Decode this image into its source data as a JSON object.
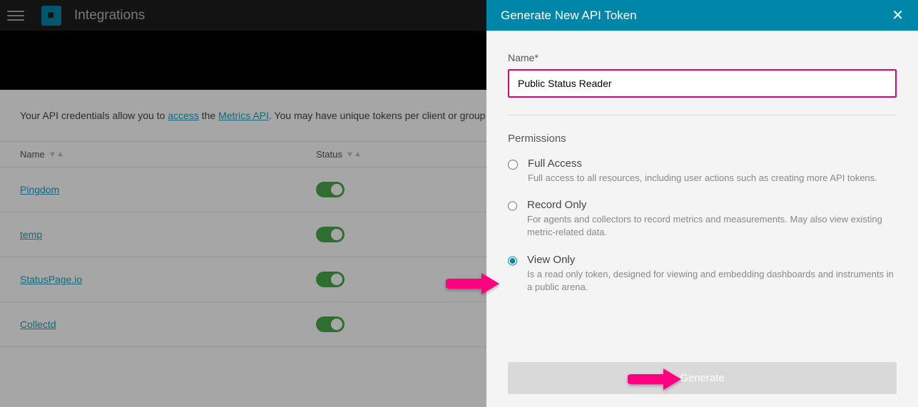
{
  "header": {
    "title": "Integrations"
  },
  "intro": {
    "prefix": "Your API credentials allow you to ",
    "link1": "access",
    "mid": " the ",
    "link2": "Metrics API",
    "suffix": ". You may have unique tokens per client or group of clients."
  },
  "table": {
    "col_name": "Name",
    "col_status": "Status",
    "rows": [
      {
        "name": "Pingdom"
      },
      {
        "name": "temp"
      },
      {
        "name": "StatusPage.io"
      },
      {
        "name": "Collectd"
      }
    ]
  },
  "panel": {
    "title": "Generate New API Token",
    "name_label": "Name*",
    "name_value": "Public Status Reader",
    "permissions_label": "Permissions",
    "options": [
      {
        "title": "Full Access",
        "desc": "Full access to all resources, including user actions such as creating more API tokens.",
        "checked": false
      },
      {
        "title": "Record Only",
        "desc": "For agents and collectors to record metrics and measurements. May also view existing metric-related data.",
        "checked": false
      },
      {
        "title": "View Only",
        "desc": "Is a read only token, designed for viewing and embedding dashboards and instruments in a public arena.",
        "checked": true
      }
    ],
    "generate": "Generate"
  }
}
